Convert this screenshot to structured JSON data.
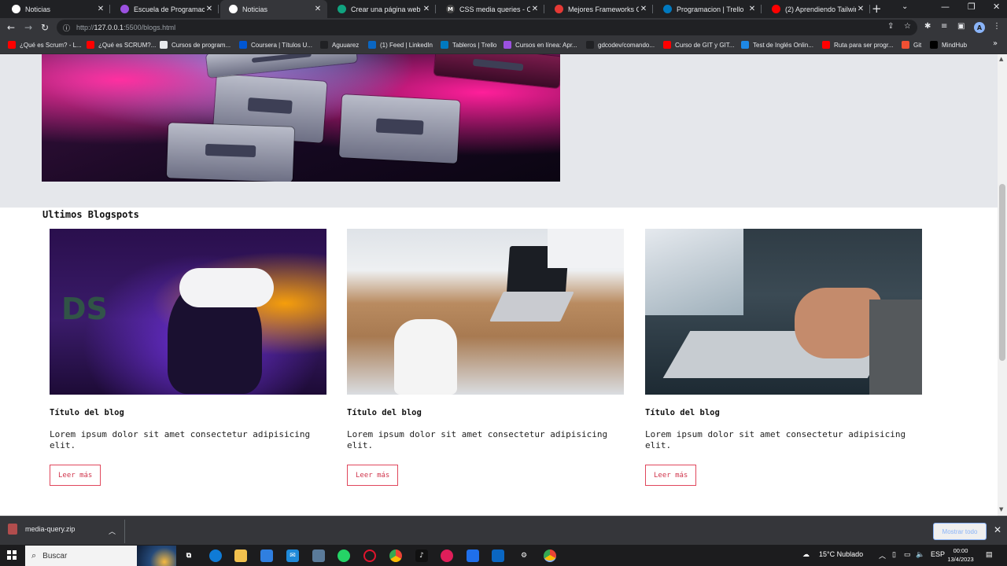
{
  "browser": {
    "tabs": [
      {
        "title": "Noticias",
        "fav_color": "#ffffff",
        "fav_text": "",
        "active": false
      },
      {
        "title": "Escuela de Programación y",
        "fav_color": "#9b51e0",
        "fav_text": "",
        "active": false
      },
      {
        "title": "Noticias",
        "fav_color": "#ffffff",
        "fav_text": "",
        "active": true
      },
      {
        "title": "Crear una página web resp",
        "fav_color": "#10a37f",
        "fav_text": "",
        "active": false
      },
      {
        "title": "CSS media queries - CSS |",
        "fav_color": "#444444",
        "fav_text": "M",
        "active": false
      },
      {
        "title": "Mejores Frameworks CSS |",
        "fav_color": "#e53935",
        "fav_text": "",
        "active": false
      },
      {
        "title": "Programacion | Trello",
        "fav_color": "#0079bf",
        "fav_text": "",
        "active": false
      },
      {
        "title": "(2) Aprendiendo Tailwind C",
        "fav_color": "#ff0000",
        "fav_text": "",
        "active": false
      }
    ],
    "close_glyph": "✕",
    "new_tab_glyph": "+",
    "url_prefix": "http://",
    "url_host": "127.0.0.1",
    "url_rest": ":5500/blogs.html",
    "profile_initial": "A",
    "bookmarks": [
      {
        "label": "¿Qué es Scrum? - L...",
        "color": "#ff0000"
      },
      {
        "label": "¿Qué es SCRUM?...",
        "color": "#ff0000"
      },
      {
        "label": "Cursos de program...",
        "color": "#e8eaed"
      },
      {
        "label": "Coursera | Títulos U...",
        "color": "#0056d2"
      },
      {
        "label": "Aguuarez",
        "color": "#202124"
      },
      {
        "label": "(1) Feed | LinkedIn",
        "color": "#0a66c2"
      },
      {
        "label": "Tableros | Trello",
        "color": "#0079bf"
      },
      {
        "label": "Cursos en línea: Apr...",
        "color": "#9b51e0"
      },
      {
        "label": "gdcodev/comando...",
        "color": "#202124"
      },
      {
        "label": "Curso de GIT y GIT...",
        "color": "#ff0000"
      },
      {
        "label": "Test de Inglés Onlin...",
        "color": "#1e88e5"
      },
      {
        "label": "Ruta para ser progr...",
        "color": "#ff0000"
      },
      {
        "label": "Git",
        "color": "#f05033"
      },
      {
        "label": "MindHub",
        "color": "#000000"
      }
    ]
  },
  "page": {
    "section_title": "Ultimos Blogspots",
    "cards": [
      {
        "title": "Título del blog",
        "text": "Lorem ipsum dolor sit amet consectetur adipisicing elit.",
        "button": "Leer más"
      },
      {
        "title": "Título del blog",
        "text": "Lorem ipsum dolor sit amet consectetur adipisicing elit.",
        "button": "Leer más"
      },
      {
        "title": "Título del blog",
        "text": "Lorem ipsum dolor sit amet consectetur adipisicing elit.",
        "button": "Leer más"
      }
    ]
  },
  "downloads": {
    "file": "media-query.zip",
    "show_all": "Mostrar todo"
  },
  "taskbar": {
    "search_placeholder": "Buscar",
    "weather": "15°C  Nublado",
    "lang": "ESP",
    "time": "00:00",
    "date": "13/4/2023"
  }
}
